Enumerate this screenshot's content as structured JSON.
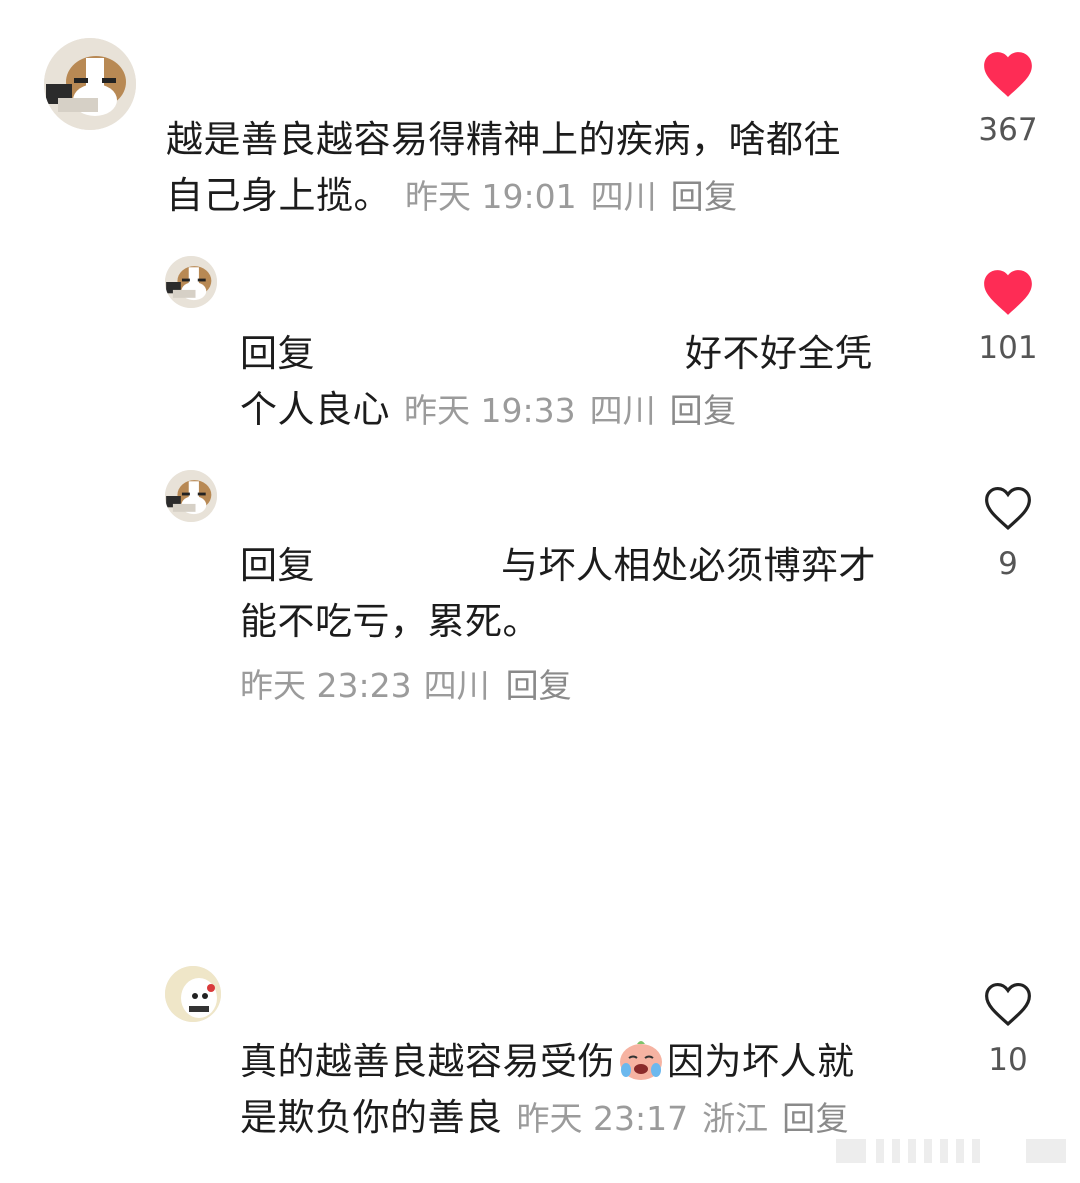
{
  "comments": [
    {
      "text": "越是善良越容易得精神上的疾病，啥都往自己身上揽。",
      "line1": "越是善良越容易得精神上的疾病，啥都往",
      "line2": "自己身上揽。",
      "time": "昨天 19:01",
      "location": "四川",
      "reply_label": "回复",
      "likes": "367",
      "liked": true
    },
    {
      "reply_prefix": "回复",
      "line1_tail": "好不好全凭",
      "line2": "个人良心",
      "time": "昨天 19:33",
      "location": "四川",
      "reply_label": "回复",
      "likes": "101",
      "liked": true
    },
    {
      "reply_prefix": "回复",
      "line1_tail": "与坏人相处必须博弈才",
      "line2": "能不吃亏，累死。",
      "time": "昨天 23:23",
      "location": "四川",
      "reply_label": "回复",
      "likes": "9",
      "liked": false
    },
    {
      "line1": "真的越善良越容易受伤",
      "line1_tail": "因为坏人就",
      "line2": "是欺负你的善良",
      "emoji": "crying-face-emoji",
      "time": "昨天 23:17",
      "location": "浙江",
      "reply_label": "回复",
      "likes": "10",
      "liked": false
    }
  ],
  "colors": {
    "like_active": "#fe2c55",
    "meta_text": "#9b9b9b",
    "body_text": "#1c1c1c",
    "like_outline": "#222222"
  }
}
